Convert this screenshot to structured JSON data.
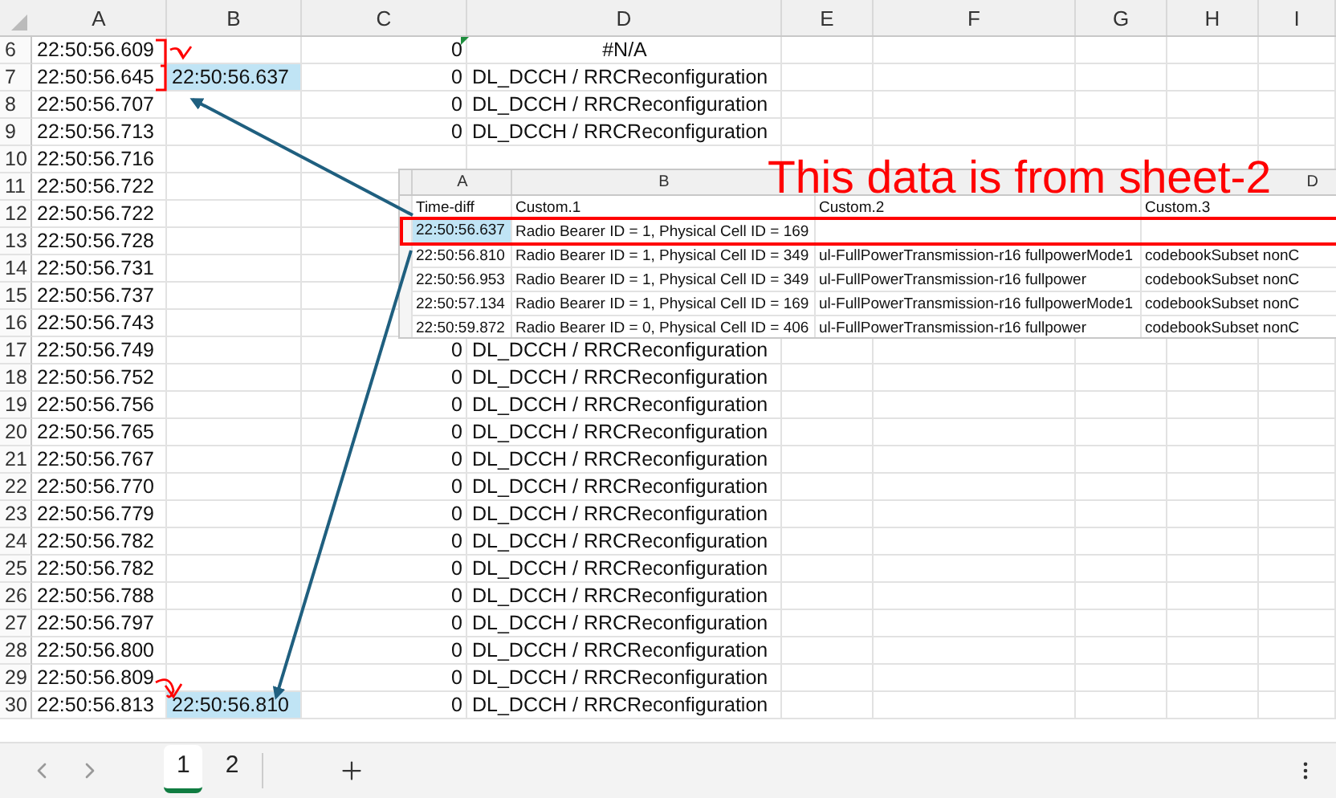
{
  "columns": [
    "A",
    "B",
    "C",
    "D",
    "E",
    "F",
    "G",
    "H",
    "I"
  ],
  "rows": [
    {
      "number": "6",
      "a": "22:50:56.609",
      "c": "0",
      "d": "#N/A",
      "kind": "error",
      "b_highlighted": false,
      "c_flagged": true
    },
    {
      "number": "7",
      "a": "22:50:56.645",
      "b": "22:50:56.637",
      "c": "0",
      "d": "DL_DCCH / RRCReconfiguration",
      "b_highlighted": true,
      "c_flagged": false
    },
    {
      "number": "8",
      "a": "22:50:56.707",
      "c": "0",
      "d": "DL_DCCH / RRCReconfiguration",
      "b_highlighted": false,
      "c_flagged": false
    },
    {
      "number": "9",
      "a": "22:50:56.713",
      "c": "0",
      "d": "DL_DCCH / RRCReconfiguration",
      "b_highlighted": false,
      "c_flagged": false
    },
    {
      "number": "10",
      "a": "22:50:56.716",
      "b_highlighted": false,
      "c_flagged": false
    },
    {
      "number": "11",
      "a": "22:50:56.722",
      "b_highlighted": false,
      "c_flagged": false
    },
    {
      "number": "12",
      "a": "22:50:56.722",
      "b_highlighted": false,
      "c_flagged": false
    },
    {
      "number": "13",
      "a": "22:50:56.728",
      "b_highlighted": false,
      "c_flagged": false
    },
    {
      "number": "14",
      "a": "22:50:56.731",
      "b_highlighted": false,
      "c_flagged": false
    },
    {
      "number": "15",
      "a": "22:50:56.737",
      "b_highlighted": false,
      "c_flagged": false
    },
    {
      "number": "16",
      "a": "22:50:56.743",
      "b_highlighted": false,
      "c_flagged": false
    },
    {
      "number": "17",
      "a": "22:50:56.749",
      "c": "0",
      "d": "DL_DCCH / RRCReconfiguration",
      "b_highlighted": false,
      "c_flagged": false
    },
    {
      "number": "18",
      "a": "22:50:56.752",
      "c": "0",
      "d": "DL_DCCH / RRCReconfiguration",
      "b_highlighted": false,
      "c_flagged": false
    },
    {
      "number": "19",
      "a": "22:50:56.756",
      "c": "0",
      "d": "DL_DCCH / RRCReconfiguration",
      "b_highlighted": false,
      "c_flagged": false
    },
    {
      "number": "20",
      "a": "22:50:56.765",
      "c": "0",
      "d": "DL_DCCH / RRCReconfiguration",
      "b_highlighted": false,
      "c_flagged": false
    },
    {
      "number": "21",
      "a": "22:50:56.767",
      "c": "0",
      "d": "DL_DCCH / RRCReconfiguration",
      "b_highlighted": false,
      "c_flagged": false
    },
    {
      "number": "22",
      "a": "22:50:56.770",
      "c": "0",
      "d": "DL_DCCH / RRCReconfiguration",
      "b_highlighted": false,
      "c_flagged": false
    },
    {
      "number": "23",
      "a": "22:50:56.779",
      "c": "0",
      "d": "DL_DCCH / RRCReconfiguration",
      "b_highlighted": false,
      "c_flagged": false
    },
    {
      "number": "24",
      "a": "22:50:56.782",
      "c": "0",
      "d": "DL_DCCH / RRCReconfiguration",
      "b_highlighted": false,
      "c_flagged": false
    },
    {
      "number": "25",
      "a": "22:50:56.782",
      "c": "0",
      "d": "DL_DCCH / RRCReconfiguration",
      "b_highlighted": false,
      "c_flagged": false
    },
    {
      "number": "26",
      "a": "22:50:56.788",
      "c": "0",
      "d": "DL_DCCH / RRCReconfiguration",
      "b_highlighted": false,
      "c_flagged": false
    },
    {
      "number": "27",
      "a": "22:50:56.797",
      "c": "0",
      "d": "DL_DCCH / RRCReconfiguration",
      "b_highlighted": false,
      "c_flagged": false
    },
    {
      "number": "28",
      "a": "22:50:56.800",
      "c": "0",
      "d": "DL_DCCH / RRCReconfiguration",
      "b_highlighted": false,
      "c_flagged": false
    },
    {
      "number": "29",
      "a": "22:50:56.809",
      "c": "0",
      "d": "DL_DCCH / RRCReconfiguration",
      "b_highlighted": false,
      "c_flagged": false
    },
    {
      "number": "30",
      "a": "22:50:56.813",
      "b": "22:50:56.810",
      "c": "0",
      "d": "DL_DCCH / RRCReconfiguration",
      "b_highlighted": true,
      "c_flagged": false
    }
  ],
  "inset": {
    "column_headers": [
      "A",
      "B",
      "D"
    ],
    "rows": [
      {
        "cells": [
          "Time-diff",
          "Custom.1",
          "Custom.2",
          "Custom.3"
        ],
        "highlighted": false
      },
      {
        "cells": [
          "22:50:56.637",
          "Radio Bearer ID = 1, Physical Cell ID = 169"
        ],
        "highlighted": true
      },
      {
        "cells": [
          "22:50:56.810",
          "Radio Bearer ID = 1, Physical Cell ID = 349",
          "ul-FullPowerTransmission-r16 fullpowerMode1",
          "codebookSubset nonC"
        ],
        "highlighted": false
      },
      {
        "cells": [
          "22:50:56.953",
          "Radio Bearer ID = 1, Physical Cell ID = 349",
          "ul-FullPowerTransmission-r16 fullpower",
          "codebookSubset nonC"
        ],
        "highlighted": false
      },
      {
        "cells": [
          "22:50:57.134",
          "Radio Bearer ID = 1, Physical Cell ID = 169",
          "ul-FullPowerTransmission-r16 fullpowerMode1",
          "codebookSubset nonC"
        ],
        "highlighted": false
      },
      {
        "cells": [
          "22:50:59.872",
          "Radio Bearer ID = 0, Physical Cell ID = 406",
          "ul-FullPowerTransmission-r16 fullpower",
          "codebookSubset nonC"
        ],
        "highlighted": false
      }
    ]
  },
  "annotation": {
    "text": "This data is from sheet-2"
  },
  "sheet_tabs": [
    {
      "label": "1",
      "selected": true
    },
    {
      "label": "2",
      "selected": false
    }
  ]
}
